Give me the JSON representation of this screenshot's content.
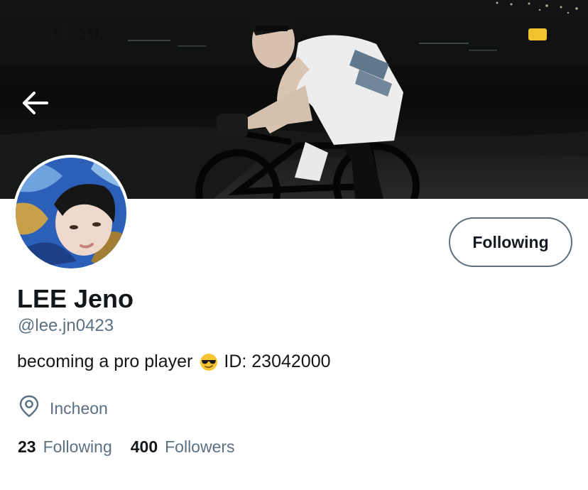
{
  "status_bar": {
    "time": "13:40",
    "battery_color": "#f2c12e"
  },
  "header": {
    "back_icon": "arrow-left-icon"
  },
  "profile": {
    "display_name": "LEE Jeno",
    "handle": "@lee.jn0423",
    "follow_button_label": "Following",
    "bio_text": "becoming a pro player",
    "bio_emoji": "sunglasses-face-emoji",
    "bio_id": "ID: 23042000",
    "location_icon": "location-pin-icon",
    "location": "Incheon"
  },
  "stats": {
    "following_count": "23",
    "following_label": "Following",
    "followers_count": "400",
    "followers_label": "Followers"
  },
  "colors": {
    "text_primary": "#14171a",
    "text_secondary": "#5b7083",
    "button_border": "#5f6f7d"
  }
}
